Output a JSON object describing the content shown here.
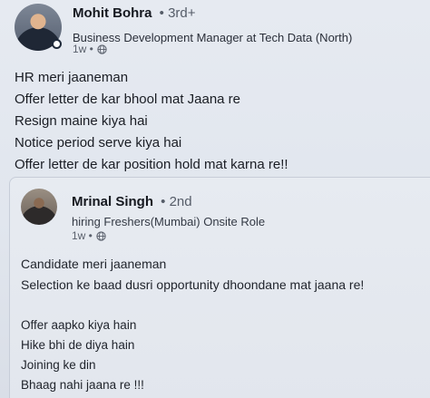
{
  "post": {
    "author_name": "Mohit Bohra",
    "connection_degree": "• 3rd+",
    "headline": "Business Development Manager at Tech Data (North)",
    "time_ago": "1w •",
    "visibility_icon": "globe-icon",
    "lines": [
      "HR meri jaaneman",
      "Offer letter de kar bhool mat Jaana re",
      "Resign maine kiya hai",
      "Notice period serve kiya hai",
      "Offer letter de kar position hold mat karna re!!"
    ]
  },
  "reshared_post": {
    "author_name": "Mrinal Singh",
    "connection_degree": "• 2nd",
    "headline": "hiring Freshers(Mumbai) Onsite Role",
    "time_ago": "1w •",
    "visibility_icon": "globe-icon",
    "lines": [
      "Candidate meri jaaneman",
      "Selection ke baad dusri opportunity dhoondane mat jaana re!"
    ],
    "lines_stanza2": [
      "Offer aapko kiya hain",
      "Hike bhi de diya hain",
      "Joining ke din",
      "Bhaag nahi jaana re !!!"
    ]
  },
  "colors": {
    "background": "#e1e6ee",
    "text_primary": "#1a1d24",
    "text_secondary": "#5a606c",
    "card_border": "#c7cdd8"
  }
}
